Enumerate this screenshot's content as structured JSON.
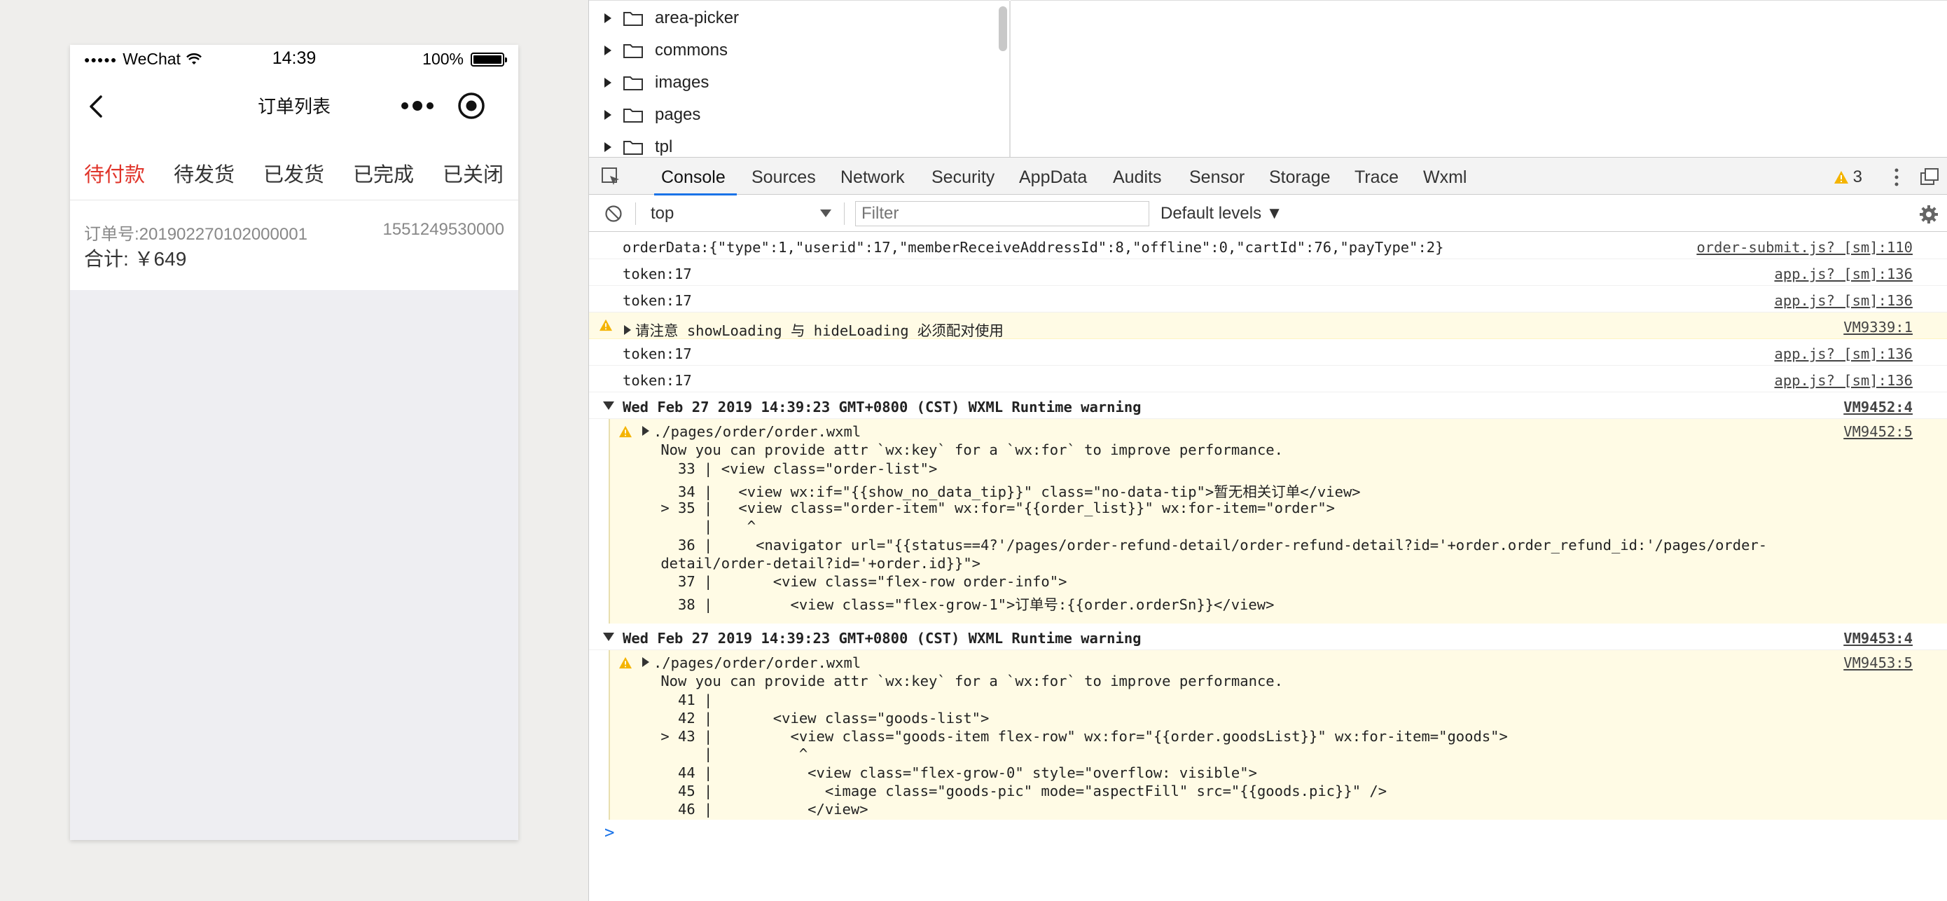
{
  "simulator": {
    "status": {
      "carrier": "WeChat",
      "time": "14:39",
      "battery": "100%"
    },
    "nav": {
      "title": "订单列表"
    },
    "tabs": [
      "待付款",
      "待发货",
      "已发货",
      "已完成",
      "已关闭"
    ],
    "active_tab": 0,
    "order": {
      "sn": "订单号:201902270102000001",
      "timestamp": "1551249530000",
      "total": "合计: ￥649"
    },
    "colors": {
      "accent": "#e0352b"
    }
  },
  "devtools": {
    "file_tree": [
      "area-picker",
      "commons",
      "images",
      "pages",
      "tpl"
    ],
    "tabs": [
      "Console",
      "Sources",
      "Network",
      "Security",
      "AppData",
      "Audits",
      "Sensor",
      "Storage",
      "Trace",
      "Wxml"
    ],
    "active_tab": "Console",
    "warning_count": "3",
    "filter": {
      "context": "top",
      "placeholder": "Filter",
      "levels": "Default levels ▼"
    },
    "console": {
      "logs": [
        {
          "msg": "orderData:{\"type\":1,\"userid\":17,\"memberReceiveAddressId\":8,\"offline\":0,\"cartId\":76,\"payType\":2}",
          "src": "order-submit.js? [sm]:110"
        },
        {
          "msg": "token:17",
          "src": "app.js? [sm]:136"
        },
        {
          "msg": "token:17",
          "src": "app.js? [sm]:136"
        },
        {
          "msg": "请注意 showLoading 与 hideLoading 必须配对使用",
          "src": "VM9339:1"
        },
        {
          "msg": "token:17",
          "src": "app.js? [sm]:136"
        },
        {
          "msg": "token:17",
          "src": "app.js? [sm]:136"
        }
      ],
      "groups": [
        {
          "header": "Wed Feb 27 2019 14:39:23 GMT+0800 (CST) WXML Runtime warning",
          "header_src": "VM9452:4",
          "file": "./pages/order/order.wxml",
          "file_src": "VM9452:5",
          "lines": [
            " Now you can provide attr `wx:key` for a `wx:for` to improve performance.",
            "   33 | <view class=\"order-list\">",
            "   34 |   <view wx:if=\"{{show_no_data_tip}}\" class=\"no-data-tip\">暂无相关订单</view>",
            " > 35 |   <view class=\"order-item\" wx:for=\"{{order_list}}\" wx:for-item=\"order\">",
            "      |    ^",
            "   36 |     <navigator url=\"{{status==4?'/pages/order-refund-detail/order-refund-detail?id='+order.order_refund_id:'/pages/order-",
            " detail/order-detail?id='+order.id}}\">",
            "   37 |       <view class=\"flex-row order-info\">",
            "   38 |         <view class=\"flex-grow-1\">订单号:{{order.orderSn}}</view>"
          ]
        },
        {
          "header": "Wed Feb 27 2019 14:39:23 GMT+0800 (CST) WXML Runtime warning",
          "header_src": "VM9453:4",
          "file": "./pages/order/order.wxml",
          "file_src": "VM9453:5",
          "lines": [
            " Now you can provide attr `wx:key` for a `wx:for` to improve performance.",
            "   41 |",
            "   42 |       <view class=\"goods-list\">",
            " > 43 |         <view class=\"goods-item flex-row\" wx:for=\"{{order.goodsList}}\" wx:for-item=\"goods\">",
            "      |          ^",
            "   44 |           <view class=\"flex-grow-0\" style=\"overflow: visible\">",
            "   45 |             <image class=\"goods-pic\" mode=\"aspectFill\" src=\"{{goods.pic}}\" />",
            "   46 |           </view>"
          ]
        }
      ],
      "prompt": ">"
    }
  }
}
